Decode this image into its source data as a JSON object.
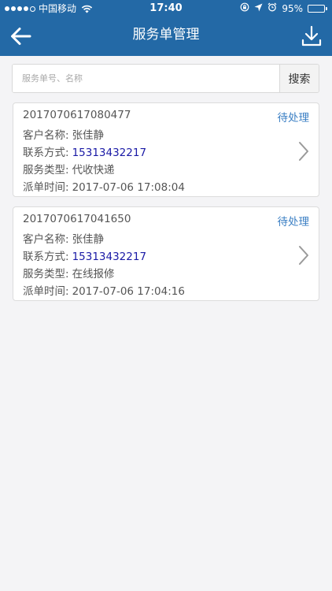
{
  "status_bar": {
    "carrier": "中国移动",
    "time": "17:40",
    "battery": "95%",
    "battery_level": 0.95,
    "icons": [
      "signal-dots",
      "wifi-icon",
      "screen-lock-icon",
      "location-icon",
      "alarm-icon",
      "battery-icon"
    ]
  },
  "nav": {
    "title": "服务单管理",
    "back_icon": "back-arrow-icon",
    "download_icon": "download-icon"
  },
  "search": {
    "placeholder": "服务单号、名称",
    "value": "",
    "button_label": "搜索"
  },
  "orders": [
    {
      "number": "2017070617080477",
      "status": "待处理",
      "customer_label": "客户名称:",
      "customer": "张佳静",
      "contact_label": "联系方式:",
      "contact": "15313432217",
      "type_label": "服务类型:",
      "type": "代收快递",
      "time_label": "派单时间:",
      "time": "2017-07-06 17:08:04"
    },
    {
      "number": "2017070617041650",
      "status": "待处理",
      "customer_label": "客户名称:",
      "customer": "张佳静",
      "contact_label": "联系方式:",
      "contact": "15313432217",
      "type_label": "服务类型:",
      "type": "在线报修",
      "time_label": "派单时间:",
      "time": "2017-07-06 17:04:16"
    }
  ],
  "colors": {
    "header": "#2369a6",
    "background": "#f4f4f6",
    "status_accent": "#3b7fc4",
    "phone": "#1a1aa6"
  }
}
